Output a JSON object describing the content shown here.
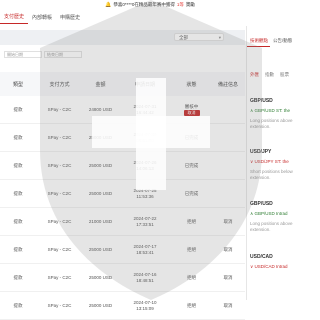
{
  "banner": {
    "prefix": "恭喜0****0在精品最年赛中獲得",
    "highlight": "1等",
    "suffix": "獎勵"
  },
  "topnav": {
    "tabs": [
      "支付歷史",
      "內部轉帳",
      "申購歷史"
    ]
  },
  "search": {
    "placeholder": "全部"
  },
  "filters": {
    "start_date": "開始日期",
    "end_date": "結束日期"
  },
  "table": {
    "columns": [
      "類型",
      "支付方式",
      "金額",
      "申請日期",
      "狀態",
      "備註信息"
    ],
    "rows": [
      {
        "type": "提款",
        "method": "SPay - C2C",
        "amount": "24800 USD",
        "date": "2024-07-31",
        "time": "16:44:42",
        "status": "審核中",
        "btn": "取消",
        "note": ""
      },
      {
        "type": "提款",
        "method": "SPay - C2C",
        "amount": "25000 USD",
        "date": "2024-07-30",
        "time": "08:51:00",
        "status": "已完成",
        "btn": "",
        "note": ""
      },
      {
        "type": "提款",
        "method": "SPay - C2C",
        "amount": "25000 USD",
        "date": "2024-07-26",
        "time": "14:06:13",
        "status": "已完成",
        "btn": "",
        "note": ""
      },
      {
        "type": "提款",
        "method": "SPay - C2C",
        "amount": "25000 USD",
        "date": "2024-07-25",
        "time": "11:53:36",
        "status": "已完成",
        "btn": "",
        "note": ""
      },
      {
        "type": "提款",
        "method": "SPay - C2C",
        "amount": "21000 USD",
        "date": "2024-07-22",
        "time": "17:33:51",
        "status": "拒絕",
        "btn": "",
        "note": "取消"
      },
      {
        "type": "提款",
        "method": "SPay - C2C",
        "amount": "25000 USD",
        "date": "2024-07-17",
        "time": "18:53:41",
        "status": "拒絕",
        "btn": "",
        "note": "取消"
      },
      {
        "type": "提款",
        "method": "SPay - C2C",
        "amount": "25000 USD",
        "date": "2024-07-16",
        "time": "18:48:51",
        "status": "拒絕",
        "btn": "",
        "note": "取消"
      },
      {
        "type": "提款",
        "method": "SPay - C2C",
        "amount": "25000 USD",
        "date": "2024-07-10",
        "time": "13:15:09",
        "status": "拒絕",
        "btn": "",
        "note": "取消"
      }
    ]
  },
  "right": {
    "tabs": [
      "技術觀點",
      "公告/動態"
    ],
    "subtabs": [
      "外匯",
      "指數",
      "股票"
    ],
    "news": [
      {
        "symbol": "GBP/USD",
        "headline": "GBP/USD ST: the",
        "desc1": "Long positions above",
        "desc2": "extension.",
        "color": "green"
      },
      {
        "symbol": "USD/JPY",
        "headline": "USD/JPY ST: the",
        "desc1": "Short positions below",
        "desc2": "extension.",
        "color": "red"
      },
      {
        "symbol": "GBP/USD",
        "headline": "GBP/USD Intrad",
        "desc1": "Long positions above",
        "desc2": "extension.",
        "color": "green"
      },
      {
        "symbol": "USD/CAD",
        "headline": "USD/CAD Intrad",
        "desc1": "",
        "desc2": "",
        "color": "red"
      }
    ]
  },
  "colors": {
    "accent": "#c62828",
    "positive": "#2e7d32",
    "watermark": "#888888"
  }
}
